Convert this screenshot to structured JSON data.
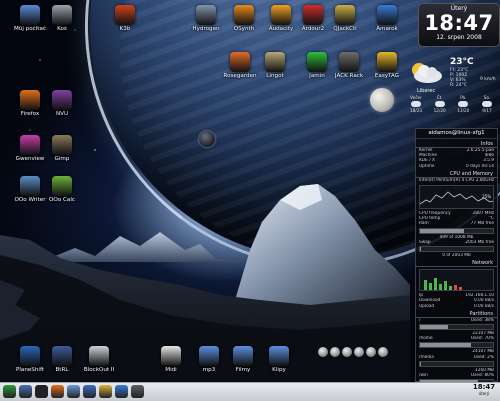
{
  "desktop": {
    "icons": [
      {
        "label": "Můj počítač",
        "icon": "computer-icon",
        "color": "#5b8ad4"
      },
      {
        "label": "Koš",
        "icon": "trash-icon",
        "color": "#9aa3ad"
      },
      {
        "label": "K3b",
        "icon": "k3b-icon",
        "color": "#d0421c"
      },
      {
        "label": "Hydrogen",
        "icon": "hydrogen-icon",
        "color": "#8593ad"
      },
      {
        "label": "QSynth",
        "icon": "qsynth-icon",
        "color": "#e58a1e"
      },
      {
        "label": "Audacity",
        "icon": "audacity-icon",
        "color": "#f0a020"
      },
      {
        "label": "Ardour2",
        "icon": "ardour-icon",
        "color": "#d22b2b"
      },
      {
        "label": "QJackCtl",
        "icon": "qjackctl-icon",
        "color": "#c9b04a"
      },
      {
        "label": "Amarok",
        "icon": "amarok-icon",
        "color": "#3a7bd5"
      },
      {
        "label": "Rosegarden",
        "icon": "rosegarden-icon",
        "color": "#e36a2a"
      },
      {
        "label": "Lingot",
        "icon": "lingot-icon",
        "color": "#b8a878"
      },
      {
        "label": "Jamin",
        "icon": "jamin-icon",
        "color": "#2fbf3a"
      },
      {
        "label": "JACK Rack",
        "icon": "jack-rack-icon",
        "color": "#6d6d6d"
      },
      {
        "label": "EasyTAG",
        "icon": "easytag-icon",
        "color": "#e8b82a"
      },
      {
        "label": "Firefox",
        "icon": "firefox-icon",
        "color": "#e0701c"
      },
      {
        "label": "NVU",
        "icon": "nvu-icon",
        "color": "#7f3fa6"
      },
      {
        "label": "Gwenview",
        "icon": "gwenview-icon",
        "color": "#c73ea8"
      },
      {
        "label": "Gimp",
        "icon": "gimp-icon",
        "color": "#8a7a5a"
      },
      {
        "label": "OOo Writer",
        "icon": "writer-icon",
        "color": "#5a8fc8"
      },
      {
        "label": "OOo Calc",
        "icon": "calc-icon",
        "color": "#6bb33a"
      },
      {
        "label": "PlaneShift",
        "icon": "planeshift-icon",
        "color": "#2a66b8"
      },
      {
        "label": "BtRL",
        "icon": "btrl-icon",
        "color": "#3c5a9c"
      },
      {
        "label": "BlockOut II",
        "icon": "blockout-icon",
        "color": "#cfd3d8"
      },
      {
        "label": "Midi",
        "icon": "midi-folder-icon",
        "color": "#e6e6e6"
      },
      {
        "label": "mp3",
        "icon": "mp3-folder-icon",
        "color": "#5c8fe0"
      },
      {
        "label": "Filmy",
        "icon": "films-folder-icon",
        "color": "#5c8fe0"
      },
      {
        "label": "Klipy",
        "icon": "clips-folder-icon",
        "color": "#5c8fe0"
      }
    ]
  },
  "clock": {
    "day": "Úterý",
    "time": "18:47",
    "date": "12. srpen 2008"
  },
  "weather": {
    "temp": "23°C",
    "details": [
      "Ft: 23°C",
      "P: 1002",
      "V: 63%",
      "R: 24°C"
    ],
    "wind": "9 km/h",
    "city": "Liberec",
    "forecast": [
      {
        "day": "Večer",
        "temp": "18/23"
      },
      {
        "day": "Čt.",
        "temp": "12/20"
      },
      {
        "day": "Pá.",
        "temp": "13/20"
      },
      {
        "day": "So.",
        "temp": "9/17"
      }
    ]
  },
  "sysmon": {
    "user": "aidamos@linux-xfg1",
    "infos_title": "Infos",
    "infos": [
      {
        "k": "Kernel",
        "v": "2.6.25.5-pae"
      },
      {
        "k": "Machine",
        "v": "i686"
      },
      {
        "k": "KDE / X",
        "v": "3.5.9"
      },
      {
        "k": "Uptime",
        "v": "0 days 00:14"
      }
    ],
    "cpu_title": "CPU and Memory",
    "cpu_name": "Intel(R) Pentium(R) 4 CPU 2.80GHz",
    "cpu_percent": "25%",
    "cpu_rows": [
      {
        "k": "CPU frequency",
        "v": "2807 MHz"
      },
      {
        "k": "CPU temp",
        "v": "°C"
      }
    ],
    "ram_label": "Ram",
    "ram_text": "77 MB free",
    "ram_used_fraction": 0.6,
    "ram_caption": "409 of 1008 Mb",
    "swap_label": "Swap",
    "swap_text": "2003 Mb free",
    "swap_used_fraction": 0.02,
    "swap_caption": "0 of 2003 Mb",
    "net_title": "Network",
    "net_rows": [
      {
        "k": "Ip",
        "v": "192.168.1.10"
      },
      {
        "k": "Download",
        "v": "0.00 kB/s"
      },
      {
        "k": "Upload",
        "v": "0.00 kB/s"
      }
    ],
    "parts_title": "Partitions",
    "parts": [
      {
        "name": "/",
        "used": "Used: 38%",
        "size": "22107 MB",
        "fraction": 0.38
      },
      {
        "name": "/home",
        "used": "Used: 70%",
        "size": "24107 MB",
        "fraction": 0.7
      },
      {
        "name": "/media",
        "used": "Used: 2%",
        "size": "1260 MB",
        "fraction": 0.02
      },
      {
        "name": "/win",
        "used": "Used: 80%",
        "size": "38144 MB",
        "fraction": 0.8
      }
    ]
  },
  "taskbar": {
    "icons": [
      "kmenu-icon",
      "show-desktop-icon",
      "konsole-icon",
      "firefox-icon",
      "kwrite-icon",
      "konqueror-icon",
      "mail-icon",
      "amarok-icon",
      "browser-icon"
    ],
    "clock_time": "18:47",
    "clock_day": "úterý",
    "clock_date": "12.8.2008"
  }
}
